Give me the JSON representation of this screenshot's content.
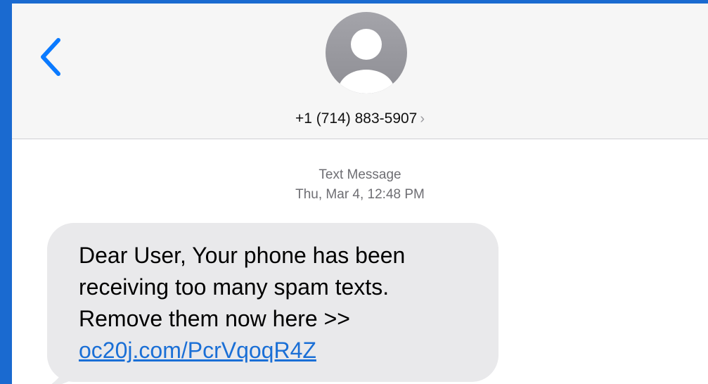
{
  "header": {
    "back_icon": "chevron-left-icon",
    "avatar_icon": "person-avatar-icon",
    "contact_number": "+1 (714) 883-5907",
    "contact_chevron": "›"
  },
  "conversation": {
    "service_label": "Text Message",
    "timestamp": "Thu, Mar 4, 12:48 PM",
    "messages": [
      {
        "direction": "incoming",
        "lines": [
          "Dear User, Your phone has been",
          "receiving too many spam texts.",
          "Remove them now here >>"
        ],
        "link": "oc20j.com/PcrVqoqR4Z"
      }
    ]
  },
  "colors": {
    "outer_background": "#1a6ad0",
    "header_background": "#f6f6f6",
    "bubble_background": "#e9e9eb",
    "link_color": "#1a6fd6",
    "ios_blue": "#0a7aff"
  }
}
